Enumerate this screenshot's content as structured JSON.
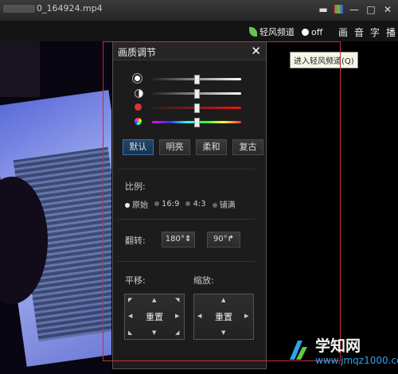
{
  "window": {
    "title": "0_164924.mp4"
  },
  "toolbar": {
    "breeze_label": "轻风频道",
    "breeze_state": "off",
    "tabs": [
      "画",
      "音",
      "字",
      "播"
    ],
    "tooltip": "进入轻风频道(Q)"
  },
  "panel": {
    "title": "画质调节",
    "sliders": [
      {
        "name": "brightness",
        "icon": "sun-icon",
        "level": 0.5
      },
      {
        "name": "contrast",
        "icon": "contrast-icon",
        "level": 0.5
      },
      {
        "name": "saturation",
        "icon": "red-dot-icon",
        "level": 0.5
      },
      {
        "name": "hue",
        "icon": "color-wheel-icon",
        "level": 0.5
      }
    ],
    "presets": [
      {
        "label": "默认",
        "active": true
      },
      {
        "label": "明亮",
        "active": false
      },
      {
        "label": "柔和",
        "active": false
      },
      {
        "label": "复古",
        "active": false
      }
    ],
    "ratio_label": "比例:",
    "ratios": [
      {
        "label": "原始",
        "selected": true
      },
      {
        "label": "16:9",
        "selected": false
      },
      {
        "label": "4:3",
        "selected": false
      },
      {
        "label": "铺满",
        "selected": false
      }
    ],
    "flip_label": "翻转:",
    "flip_180": "180°",
    "flip_90": "90°",
    "pan_label": "平移:",
    "zoom_label": "缩放:",
    "reset_label": "重置"
  },
  "watermark": {
    "text": "学知网",
    "url": "www.jmqz1000.com"
  },
  "colors": {
    "accent": "#24456a",
    "frame": "#c0303c",
    "leaf": "#6cc24a"
  }
}
